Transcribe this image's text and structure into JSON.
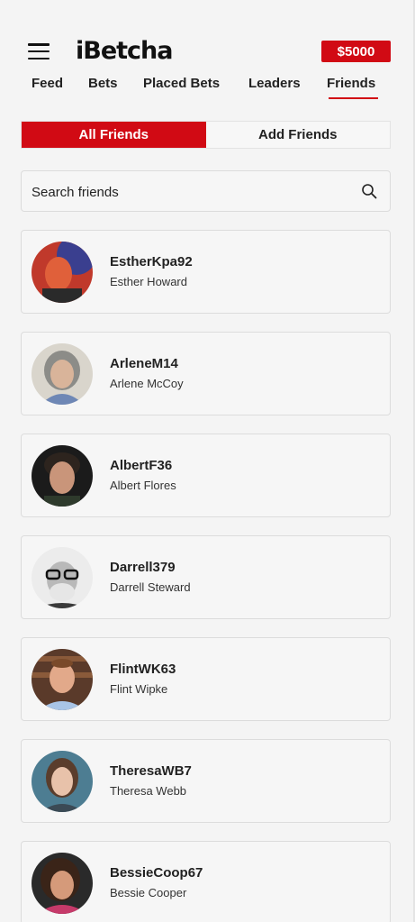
{
  "header": {
    "logo": "iBetcha",
    "balance": "$5000"
  },
  "nav": {
    "tabs": [
      "Feed",
      "Bets",
      "Placed Bets",
      "Leaders",
      "Friends"
    ],
    "active": "Friends"
  },
  "segment": {
    "all_label": "All Friends",
    "add_label": "Add Friends"
  },
  "search": {
    "placeholder": "Search friends",
    "value": ""
  },
  "friends": [
    {
      "username": "EstherKpa92",
      "name": "Esther Howard"
    },
    {
      "username": "ArleneM14",
      "name": "Arlene McCoy"
    },
    {
      "username": "AlbertF36",
      "name": "Albert Flores"
    },
    {
      "username": "Darrell379",
      "name": "Darrell Steward"
    },
    {
      "username": "FlintWK63",
      "name": "Flint Wipke"
    },
    {
      "username": "TheresaWB7",
      "name": "Theresa Webb"
    },
    {
      "username": "BessieCoop67",
      "name": "Bessie Cooper"
    }
  ],
  "colors": {
    "accent": "#d10a14",
    "background": "#f4f4f4",
    "card": "#f6f6f6"
  },
  "icons": {
    "menu": "hamburger-menu-icon",
    "search": "search-icon"
  }
}
